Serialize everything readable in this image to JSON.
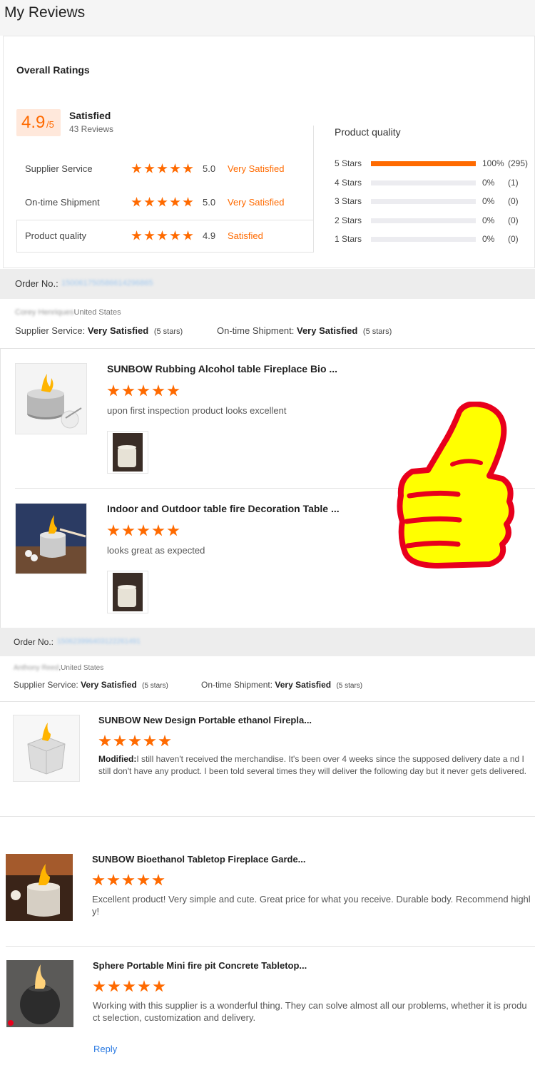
{
  "page_title": "My Reviews",
  "overall": {
    "heading": "Overall Ratings",
    "score": "4.9",
    "out_of": "/5",
    "verdict": "Satisfied",
    "count": "43 Reviews",
    "rows": [
      {
        "label": "Supplier Service",
        "score": "5.0",
        "verdict": "Very Satisfied",
        "stars": 5
      },
      {
        "label": "On-time Shipment",
        "score": "5.0",
        "verdict": "Very Satisfied",
        "stars": 5
      },
      {
        "label": "Product quality",
        "score": "4.9",
        "verdict": "Satisfied",
        "stars": 5
      }
    ]
  },
  "quality": {
    "heading": "Product quality",
    "rows": [
      {
        "label": "5 Stars",
        "pct": "100%",
        "count": "(295)",
        "fraction": 1.0
      },
      {
        "label": "4 Stars",
        "pct": "0%",
        "count": "(1)",
        "fraction": 0
      },
      {
        "label": "3 Stars",
        "pct": "0%",
        "count": "(0)",
        "fraction": 0
      },
      {
        "label": "2 Stars",
        "pct": "0%",
        "count": "(0)",
        "fraction": 0
      },
      {
        "label": "1 Stars",
        "pct": "0%",
        "count": "(0)",
        "fraction": 0
      }
    ]
  },
  "orders": [
    {
      "order_label": "Order No.:",
      "order_number": "150061750586614296865",
      "reviewer": "Corey Henriques",
      "country": "United States",
      "supplier_label": "Supplier Service:",
      "supplier_value": "Very Satisfied",
      "supplier_stars": "(5 stars)",
      "shipment_label": "On-time Shipment:",
      "shipment_value": "Very Satisfied",
      "shipment_stars": "(5 stars)",
      "products": [
        {
          "title": "SUNBOW Rubbing Alcohol table Fireplace Bio ...",
          "text": "upon first inspection product looks excellent"
        },
        {
          "title": "Indoor and Outdoor table fire Decoration Table ...",
          "text": "looks great as expected"
        }
      ]
    },
    {
      "order_label": "Order No.:",
      "order_number": "150623996403122261491",
      "reviewer": "Anthony Reed",
      "country": ",United States",
      "supplier_label": "Supplier Service:",
      "supplier_value": "Very Satisfied",
      "supplier_stars": "(5 stars)",
      "shipment_label": "On-time Shipment:",
      "shipment_value": "Very Satisfied",
      "shipment_stars": "(5 stars)",
      "products": [
        {
          "title": "SUNBOW New Design Portable ethanol Firepla...",
          "modified_label": "Modified:",
          "text": "I still haven't received the merchandise. It's been over 4 weeks since the supposed delivery date a nd I still don't have any product. I been told several times they will deliver the following day but it never gets delivered."
        }
      ]
    }
  ],
  "extra_reviews": [
    {
      "title": "SUNBOW Bioethanol Tabletop Fireplace Garde...",
      "text": "Excellent product! Very simple and cute. Great price for what you receive. Durable body. Recommend highl y!"
    },
    {
      "title": "Sphere Portable Mini fire pit Concrete Tabletop...",
      "text": "Working with this supplier is a wonderful thing. They can solve almost all our problems, whether it is produ ct selection, customization and delivery.",
      "reply": "Reply"
    }
  ],
  "colors": {
    "accent": "#ff6a00",
    "link": "#2a7ae2",
    "thumb_yellow": "#ffff00",
    "thumb_red": "#e8001c"
  }
}
